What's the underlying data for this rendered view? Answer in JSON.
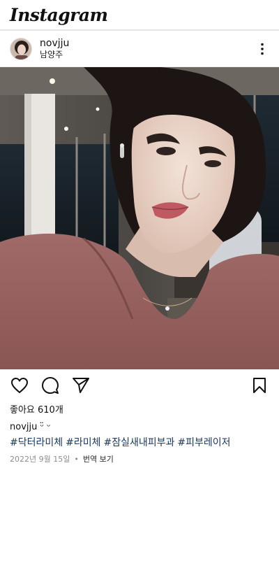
{
  "app": {
    "logo_text": "Instagram"
  },
  "post": {
    "username": "novjju",
    "location": "남양주",
    "likes_text": "좋아요 610개",
    "caption_user": "novjju",
    "caption_text": "ᵕ̈ ᵕ",
    "hashtags": [
      "#닥터라미체",
      "#라미체",
      "#잠실새내피부과",
      "#피부레이저"
    ],
    "date": "2022년 9월 15일",
    "separator": "•",
    "translate_label": "번역 보기"
  },
  "icons": {
    "more": "more-vertical-icon",
    "like": "heart-icon",
    "comment": "comment-icon",
    "share": "send-icon",
    "save": "bookmark-icon"
  }
}
